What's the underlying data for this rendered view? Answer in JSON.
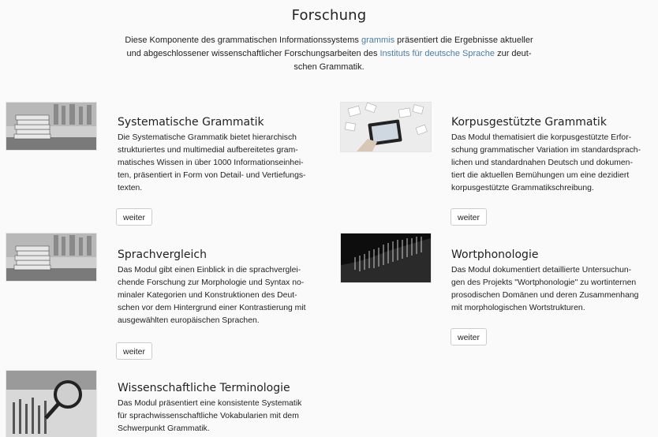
{
  "page": {
    "title": "Forschung",
    "intro": {
      "line1_a": "Diese Komponente des grammatischen Informationssystems ",
      "line1_link": "grammis",
      "line1_b": " präsentiert die Ergebnisse aktueller",
      "line2_a": "und abgeschlossener wissenschaftlicher Forschungsarbeiten des ",
      "line2_link": "Instituts für deutsche Sprache",
      "line2_b": " zur deut-",
      "line3": "schen Grammatik."
    }
  },
  "cards": {
    "systematische": {
      "title": "Systematische Grammatik",
      "lines": [
        "Die Systematische Grammatik bietet hierarchisch",
        "strukturiertes und multimedial aufbereitetes gram-",
        "matisches Wissen in über 1000 Informationseinhei-",
        "ten, präsentiert in Form von Detail- und Vertiefungs-",
        "texten."
      ],
      "button": "weiter"
    },
    "korpus": {
      "title": "Korpusgestützte Grammatik",
      "lines": [
        "Das Modul thematisiert die korpusgestützte Erfor-",
        "schung grammatischer Variation im standardsprach-",
        "lichen und standardnahen Deutsch und dokumen-",
        "tiert die aktuellen Bemühungen um eine dezidiert",
        "korpusgestützte Grammatikschreibung."
      ],
      "button": "weiter"
    },
    "sprachvergleich": {
      "title": "Sprachvergleich",
      "lines": [
        "Das Modul gibt einen Einblick in die sprachverglei-",
        "chende Forschung zur Morphologie und Syntax no-",
        "minaler Kategorien und Konstruktionen des Deut-",
        "schen vor dem Hintergrund einer Kontrastierung mit",
        "ausgewählten europäischen Sprachen."
      ],
      "button": "weiter"
    },
    "wortphonologie": {
      "title": "Wortphonologie",
      "lines": [
        "Das Modul dokumentiert detaillierte Untersuchun-",
        "gen des Projekts \"Wortphonologie\" zu wortinternen",
        "prosodischen Domänen und deren Zusammenhang",
        "mit morphologischen Wortstrukturen."
      ],
      "button": "weiter"
    },
    "terminologie": {
      "title": "Wissenschaftliche Terminologie",
      "lines": [
        "Das Modul präsentiert eine konsistente Systematik",
        "für sprachwissenschaftliche Vokabularien mit dem",
        "Schwerpunkt Grammatik."
      ]
    }
  },
  "icons": {
    "books": "books-image",
    "tablet": "tablet-documents-image",
    "waveform": "waveform-image",
    "magnifier": "magnifier-image"
  }
}
